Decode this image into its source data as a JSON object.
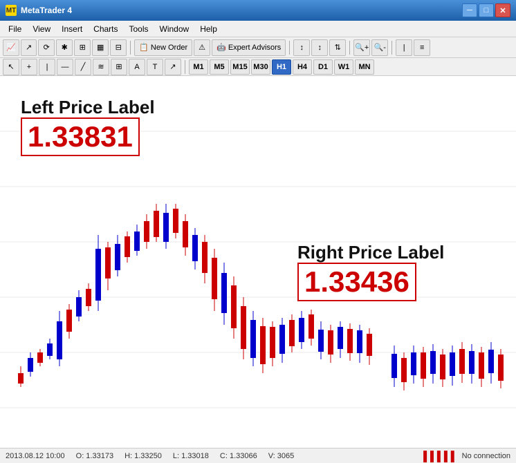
{
  "titleBar": {
    "title": "MetaTrader 4",
    "icon": "MT",
    "minimize": "─",
    "maximize": "□",
    "close": "✕"
  },
  "menuBar": {
    "items": [
      "File",
      "View",
      "Insert",
      "Charts",
      "Tools",
      "Window",
      "Help"
    ]
  },
  "toolbar1": {
    "newOrder": "New Order",
    "expertAdvisors": "Expert Advisors"
  },
  "timeframes": [
    "M1",
    "M5",
    "M15",
    "M30",
    "H1",
    "H4",
    "D1",
    "W1",
    "MN"
  ],
  "activeTimeframe": "H1",
  "chart": {
    "leftPriceTitle": "Left Price Label",
    "leftPrice": "1.33831",
    "rightPriceTitle": "Right Price Label",
    "rightPrice": "1.33436"
  },
  "statusBar": {
    "date": "2013.08.12 10:00",
    "open": "O: 1.33173",
    "high": "H: 1.33250",
    "low": "L: 1.33018",
    "close": "C: 1.33066",
    "volume": "V: 3065",
    "connection": "No connection"
  }
}
